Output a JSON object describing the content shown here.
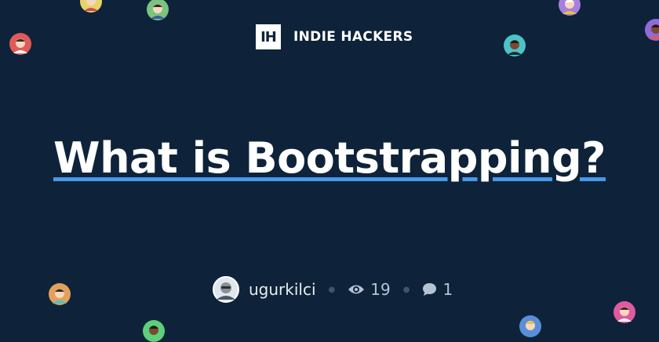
{
  "brand": {
    "logo_text": "IH",
    "name": "INDIE HACKERS"
  },
  "post": {
    "title": "What is Bootstrapping?",
    "author": "ugurkilci",
    "views": "19",
    "comments": "1"
  },
  "colors": {
    "background": "#0e2339",
    "underline": "#4799eb",
    "meta_text": "#b6c3d1"
  },
  "icons": [
    "eye-icon",
    "comment-icon"
  ]
}
